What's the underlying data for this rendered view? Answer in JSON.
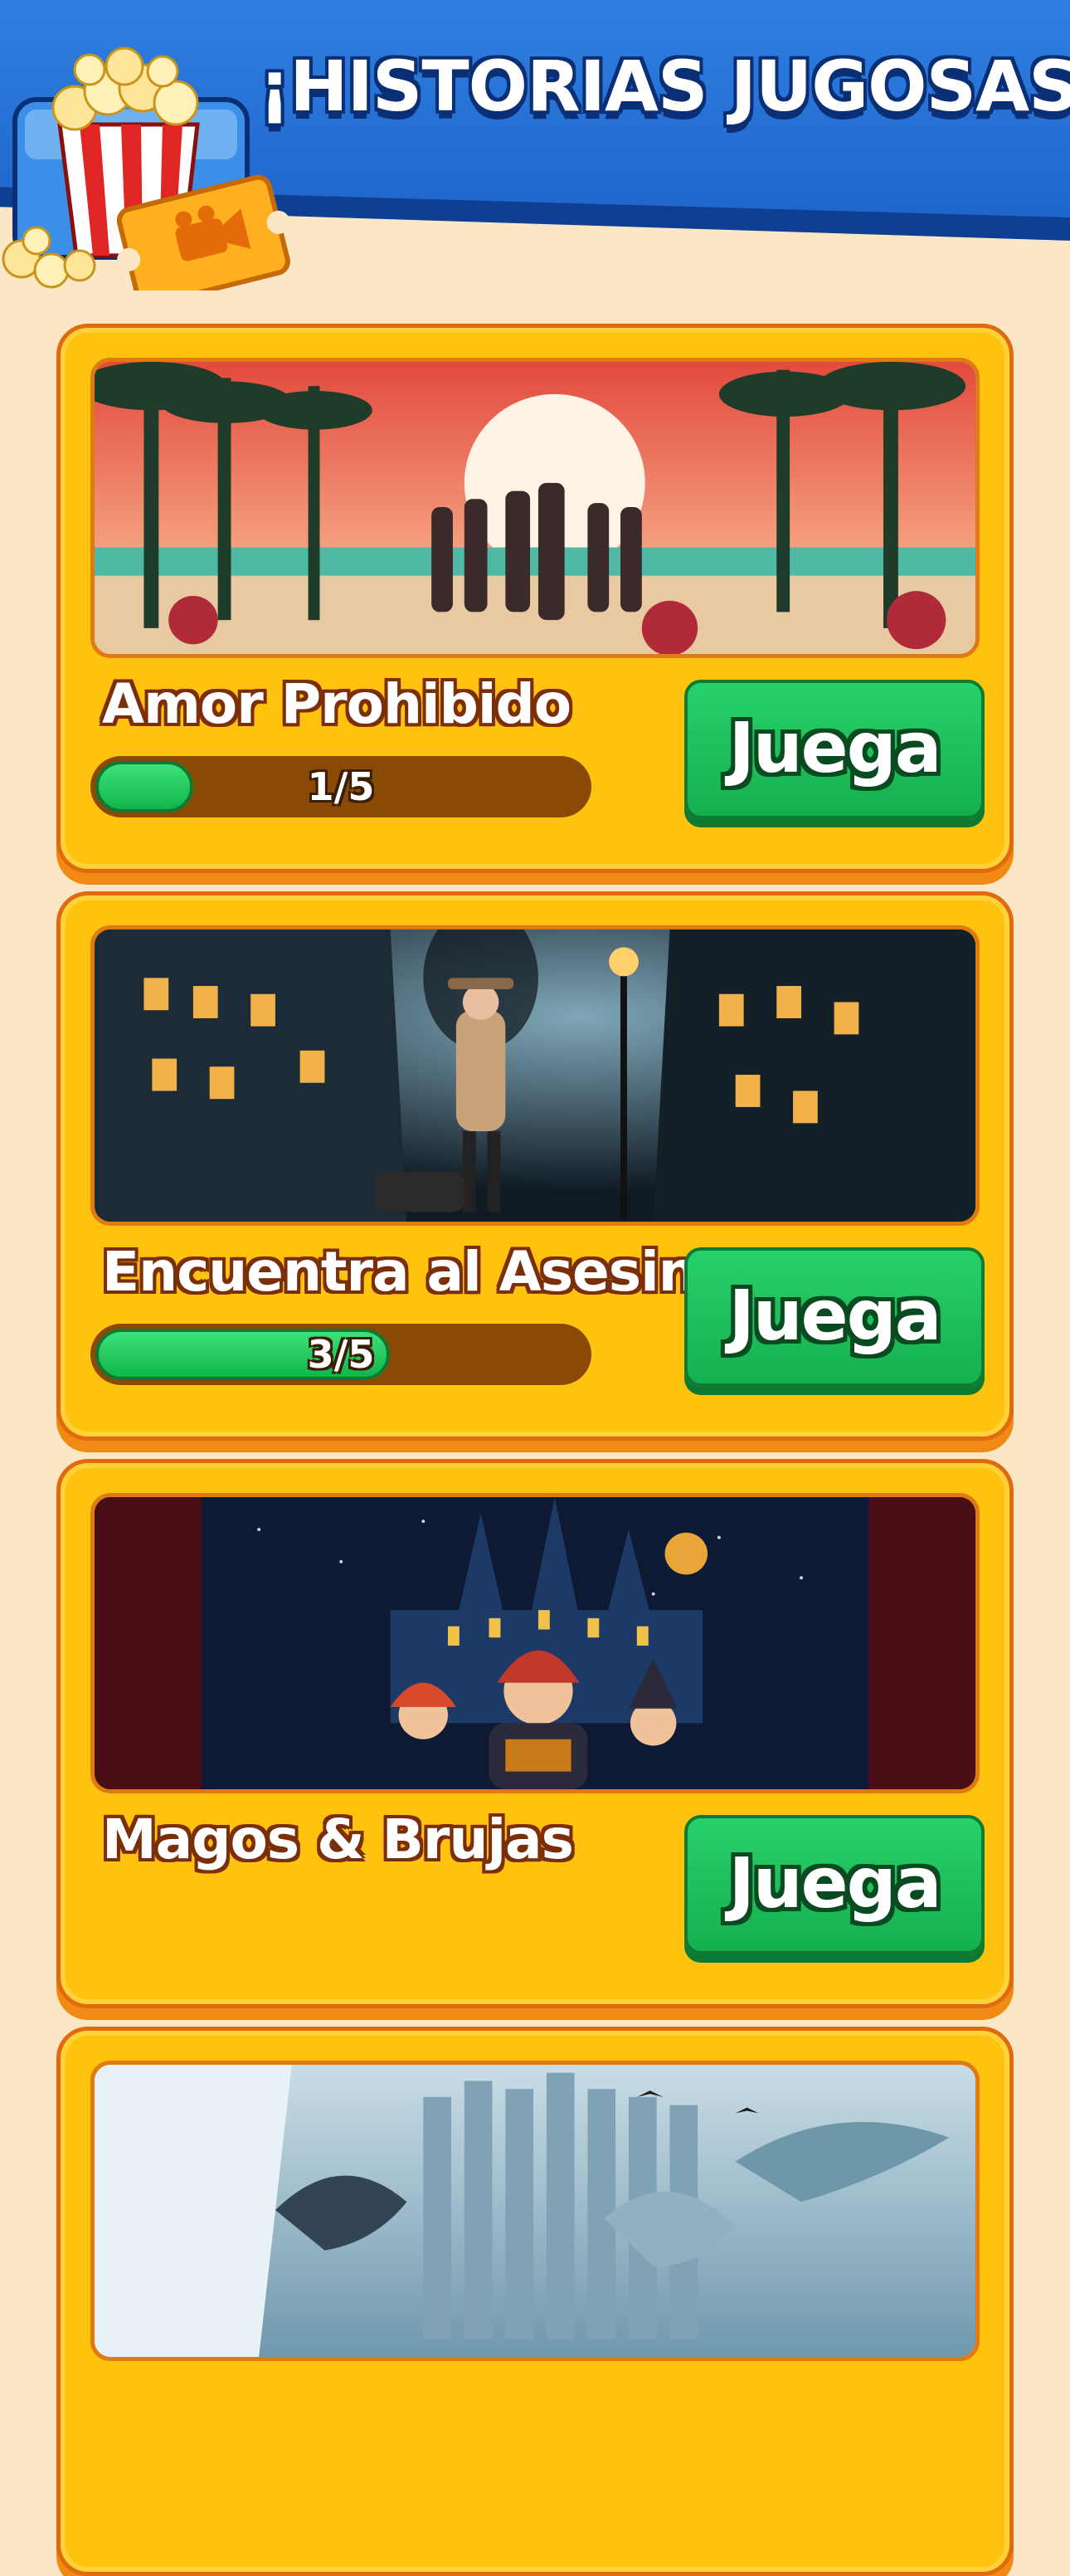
{
  "header": {
    "title": "¡HISTORIAS JUGOSAS!",
    "logo_icon": "popcorn-ticket-icon",
    "colors": {
      "band": "#2f7fe0",
      "band_shade": "#0f3f93"
    }
  },
  "stories": [
    {
      "title": "Amor Prohibido",
      "image_icon": "tropical-beach-couples-illustration",
      "progress_text": "1/5",
      "progress": 0.2,
      "button_label": "Juega"
    },
    {
      "title": "Encuentra al Asesino",
      "image_icon": "detective-night-street-illustration",
      "progress_text": "3/5",
      "progress": 0.6,
      "button_label": "Juega"
    },
    {
      "title": "Magos & Brujas",
      "image_icon": "wizard-school-castle-illustration",
      "button_label": "Juega"
    },
    {
      "image_icon": "ice-dragons-fortress-illustration"
    }
  ],
  "colors": {
    "background": "#fbe7c6",
    "card": "#ffc20e",
    "card_border": "#e06a0f",
    "button": "#1fc15c",
    "progress_fill": "#2bd06a",
    "progress_track": "#8a4a06"
  }
}
